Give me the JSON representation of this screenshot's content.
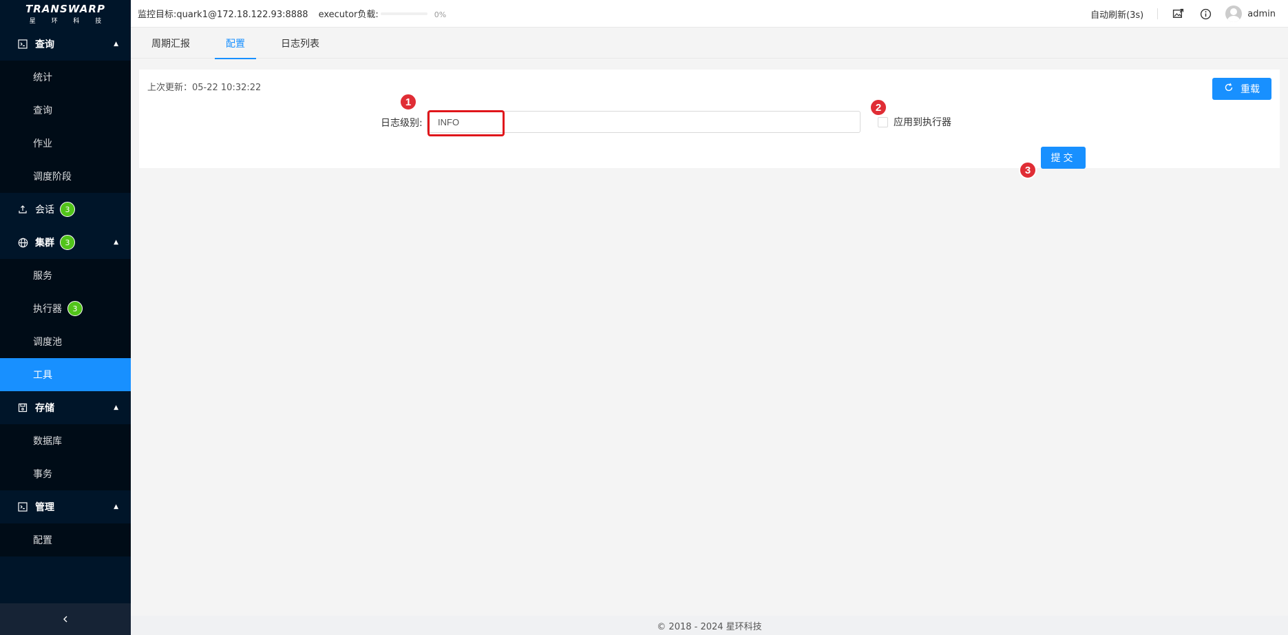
{
  "logo": {
    "main": "TRANSWARP",
    "sub": "星 环 科 技"
  },
  "sidebar": {
    "groups": [
      {
        "label": "查询",
        "icon": "terminal-icon",
        "expanded": true,
        "items": [
          {
            "label": "统计"
          },
          {
            "label": "查询"
          },
          {
            "label": "作业"
          },
          {
            "label": "调度阶段"
          }
        ]
      },
      {
        "label": "会话",
        "icon": "upload-icon",
        "badge": "3"
      },
      {
        "label": "集群",
        "icon": "globe-icon",
        "badge": "3",
        "expanded": true,
        "items": [
          {
            "label": "服务"
          },
          {
            "label": "执行器",
            "badge": "3"
          },
          {
            "label": "调度池"
          },
          {
            "label": "工具",
            "active": true
          }
        ]
      },
      {
        "label": "存储",
        "icon": "save-icon",
        "expanded": true,
        "items": [
          {
            "label": "数据库"
          },
          {
            "label": "事务"
          }
        ]
      },
      {
        "label": "管理",
        "icon": "terminal-icon",
        "expanded": true,
        "items": [
          {
            "label": "配置"
          }
        ]
      }
    ],
    "collapse_icon": "chevron-left-icon"
  },
  "header": {
    "monitor_target": "监控目标:quark1@172.18.122.93:8888",
    "executor_load_label": "executor负载:",
    "executor_load_percent": "0%",
    "executor_load_value": 0,
    "auto_refresh": "自动刷新(3s)",
    "username": "admin"
  },
  "tabs": [
    {
      "label": "周期汇报",
      "active": false
    },
    {
      "label": "配置",
      "active": true
    },
    {
      "label": "日志列表",
      "active": false
    }
  ],
  "config_panel": {
    "last_update": "上次更新：05-22 10:32:22",
    "reload_label": "重载",
    "log_level_label": "日志级别:",
    "log_level_value": "INFO",
    "apply_to_executor_label": "应用到执行器",
    "apply_to_executor_checked": false,
    "submit_label": "提交"
  },
  "markers": [
    "1",
    "2",
    "3"
  ],
  "footer": {
    "copyright": "© 2018 - 2024 星环科技"
  },
  "colors": {
    "sidebar_bg": "#001529",
    "submenu_bg": "#000c17",
    "primary": "#1890ff",
    "badge": "#52c41a",
    "highlight": "#e0161b",
    "marker": "#e02d35"
  }
}
